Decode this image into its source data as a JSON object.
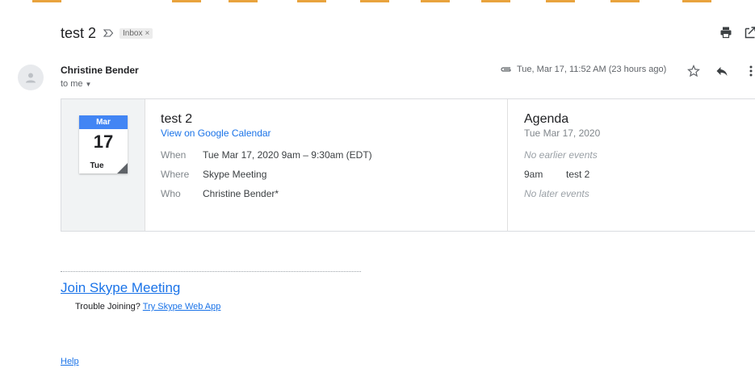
{
  "top_strip": {
    "colors": [
      "#e37400",
      "#e37400",
      "#e37400",
      "#e37400",
      "#e37400",
      "#e37400",
      "#e37400",
      "#e37400",
      "#e37400"
    ]
  },
  "email": {
    "subject": "test 2",
    "label": "Inbox",
    "label_close": "×",
    "sender": "Christine Bender",
    "recipient": "to me",
    "timestamp": "Tue, Mar 17, 11:52 AM (23 hours ago)"
  },
  "invite": {
    "calendar": {
      "month": "Mar",
      "day": "17",
      "weekday": "Tue"
    },
    "title": "test 2",
    "view_link": "View on Google Calendar",
    "details": [
      {
        "key": "When",
        "value": "Tue Mar 17, 2020 9am – 9:30am (EDT)"
      },
      {
        "key": "Where",
        "value": "Skype Meeting"
      },
      {
        "key": "Who",
        "value": "Christine Bender*"
      }
    ],
    "agenda": {
      "title": "Agenda",
      "date": "Tue Mar 17, 2020",
      "earlier": "No earlier events",
      "event_time": "9am",
      "event_name": "test 2",
      "later": "No later events"
    }
  },
  "body": {
    "join_link": "Join Skype Meeting",
    "trouble_text": "Trouble Joining?",
    "web_app_link": "Try Skype Web App",
    "help_link": "Help"
  },
  "colors": {
    "link": "#1a73e8",
    "calendar_header": "#4285f4",
    "muted": "#80868b"
  }
}
